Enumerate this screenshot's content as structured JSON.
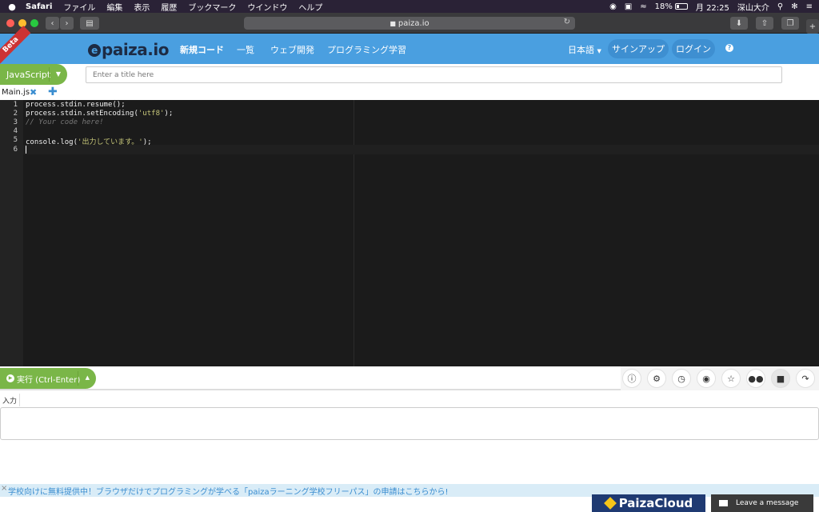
{
  "menubar": {
    "apple": "",
    "app": "Safari",
    "items": [
      "ファイル",
      "編集",
      "表示",
      "履歴",
      "ブックマーク",
      "ウインドウ",
      "ヘルプ"
    ],
    "battery": "18%",
    "clock": "月 22:25",
    "user": "深山大介"
  },
  "browser": {
    "url": "paiza.io"
  },
  "header": {
    "beta": "Beta",
    "logo": "paiza.io",
    "nav": [
      "新規コード",
      "一覧",
      "ウェブ開発",
      "プログラミング学習"
    ],
    "language": "日本語",
    "signup": "サインアップ",
    "login": "ログイン",
    "help": "?"
  },
  "toolbar": {
    "language": "JavaScript",
    "title_placeholder": "Enter a title here"
  },
  "tabs": {
    "file": "Main.js",
    "close": "✖",
    "add": "✚"
  },
  "editor": {
    "line_numbers": [
      "1",
      "2",
      "3",
      "4",
      "5",
      "6"
    ],
    "lines": [
      {
        "plain": "process.stdin.resume();"
      },
      {
        "plain": "process.stdin.setEncoding(",
        "str": "'utf8'",
        "tail": ");"
      },
      {
        "comment": "// Your code here!"
      },
      {
        "plain": ""
      },
      {
        "plain": "console.log(",
        "str": "'出力しています。'",
        "tail": ");"
      },
      {
        "plain": ""
      }
    ]
  },
  "run": {
    "label": "実行 (Ctrl-Enter)"
  },
  "tools": {
    "icons": [
      "info-icon",
      "gear-icon",
      "clock-icon",
      "github-icon",
      "star-icon",
      "people-icon",
      "lock-icon",
      "share-icon"
    ]
  },
  "input": {
    "tab": "入力"
  },
  "banner": {
    "close": "×",
    "text": "学校向けに無料提供中！ブラウザだけでプログラミングが学べる「paizaラーニング学校フリーパス」の申請はこちらから!"
  },
  "footer": {
    "cloud": "PaizaCloud",
    "chat": "Leave a message"
  }
}
